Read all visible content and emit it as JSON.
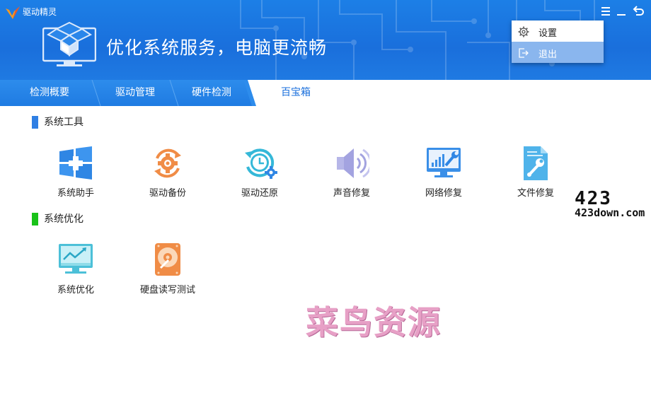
{
  "app": {
    "name": "驱动精灵",
    "hero_title": "优化系统服务，电脑更流畅"
  },
  "tabs": [
    {
      "label": "检测概要",
      "active": false
    },
    {
      "label": "驱动管理",
      "active": false
    },
    {
      "label": "硬件检测",
      "active": false
    },
    {
      "label": "百宝箱",
      "active": true
    }
  ],
  "sections": [
    {
      "title": "系统工具",
      "color": "#2f7fe4",
      "items": [
        {
          "label": "系统助手",
          "icon": "windows-plus-icon"
        },
        {
          "label": "驱动备份",
          "icon": "gear-cycle-icon"
        },
        {
          "label": "驱动还原",
          "icon": "clock-restore-icon"
        },
        {
          "label": "声音修复",
          "icon": "speaker-icon"
        },
        {
          "label": "网络修复",
          "icon": "monitor-wrench-icon"
        },
        {
          "label": "文件修复",
          "icon": "file-wrench-icon"
        }
      ]
    },
    {
      "title": "系统优化",
      "color": "#19c219",
      "items": [
        {
          "label": "系统优化",
          "icon": "monitor-chart-icon"
        },
        {
          "label": "硬盘读写测试",
          "icon": "hdd-icon"
        }
      ]
    }
  ],
  "menu": {
    "items": [
      {
        "label": "设置",
        "icon": "gear-icon",
        "highlighted": false
      },
      {
        "label": "退出",
        "icon": "exit-icon",
        "highlighted": true
      }
    ]
  },
  "watermarks": {
    "site_big": "423",
    "site_url": "423down.com",
    "cn_text": "菜鸟资源"
  },
  "colors": {
    "header_blue": "#1a6fdc",
    "menu_highlight": "#8ab6ee"
  }
}
